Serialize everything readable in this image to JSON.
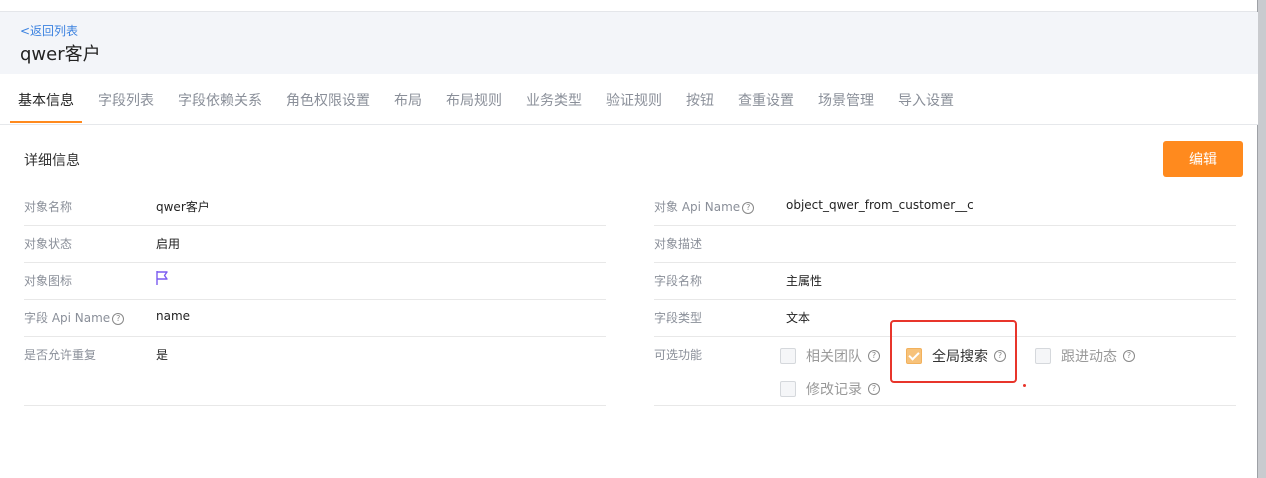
{
  "header": {
    "back_label": "<返回列表",
    "title": "qwer客户"
  },
  "tabs": [
    "基本信息",
    "字段列表",
    "字段依赖关系",
    "角色权限设置",
    "布局",
    "布局规则",
    "业务类型",
    "验证规则",
    "按钮",
    "查重设置",
    "场景管理",
    "导入设置"
  ],
  "active_tab": "基本信息",
  "section": {
    "title": "详细信息",
    "edit_label": "编辑"
  },
  "left_fields": {
    "name": {
      "label": "对象名称",
      "value": "qwer客户"
    },
    "status": {
      "label": "对象状态",
      "value": "启用"
    },
    "icon": {
      "label": "对象图标",
      "icon": "flag-icon"
    },
    "field_api": {
      "label": "字段 Api Name",
      "value": "name"
    },
    "allow_dup": {
      "label": "是否允许重复",
      "value": "是"
    }
  },
  "right_fields": {
    "api_name": {
      "label": "对象 Api Name",
      "value": "object_qwer_from_customer__c"
    },
    "desc": {
      "label": "对象描述",
      "value": ""
    },
    "field_name": {
      "label": "字段名称",
      "value": "主属性"
    },
    "field_type": {
      "label": "字段类型",
      "value": "文本"
    },
    "features": {
      "label": "可选功能"
    }
  },
  "features": [
    {
      "label": "相关团队",
      "checked": false
    },
    {
      "label": "全局搜索",
      "checked": true
    },
    {
      "label": "跟进动态",
      "checked": false
    },
    {
      "label": "修改记录",
      "checked": false
    }
  ],
  "colors": {
    "accent": "#ff8a1e",
    "link": "#3b82e0",
    "highlight": "#e8352b"
  }
}
